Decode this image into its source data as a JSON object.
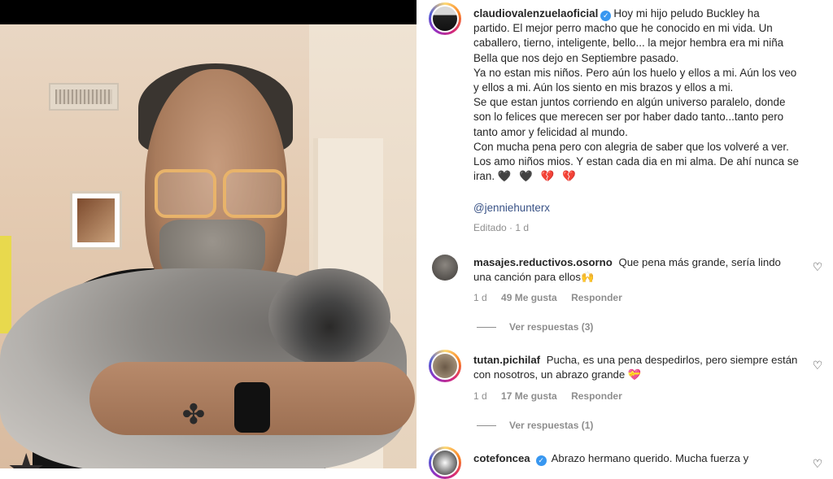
{
  "post": {
    "username": "claudiovalenzuelaoficial",
    "caption_lines": [
      "Hoy mi hijo peludo Buckley ha partido. El mejor perro macho que he conocido en mi vida. Un caballero, tierno, inteligente, bello... la mejor hembra era mi niña Bella que nos dejo en Septiembre pasado.",
      "Ya no estan mis niños. Pero aún los huelo y ellos a mi. Aún los veo y ellos a mi. Aún los siento en mis brazos y ellos a mi.",
      "Se que estan juntos corriendo en algún universo paralelo, donde son lo felices que merecen ser por haber dado tanto...tanto pero tanto amor y felicidad al mundo.",
      "Con mucha pena pero con alegria de saber que los volveré a ver. Los amo niños mios. Y estan cada dia en mi alma. De ahí nunca se iran."
    ],
    "caption_emojis": "🖤 🖤 💔 💔",
    "mention": "@jenniehunterx",
    "edited_label": "Editado · 1 d"
  },
  "comments": [
    {
      "username": "masajes.reductivos.osorno",
      "text": "Que pena más grande, sería lindo una canción para ellos🙌",
      "time": "1 d",
      "likes": "49 Me gusta",
      "reply_label": "Responder",
      "view_replies": "Ver respuestas (3)"
    },
    {
      "username": "tutan.pichilaf",
      "text": "Pucha, es una pena despedirlos, pero siempre están con nosotros, un abrazo grande 💝",
      "time": "1 d",
      "likes": "17 Me gusta",
      "reply_label": "Responder",
      "view_replies": "Ver respuestas (1)"
    },
    {
      "username": "cotefoncea",
      "text": "Abrazo hermano querido. Mucha fuerza y"
    }
  ],
  "icons": {
    "verified": "verified-badge-icon",
    "like": "heart-outline-icon"
  },
  "colors": {
    "verified": "#3897f0",
    "mention": "#385185",
    "meta": "#8e8e8e"
  }
}
